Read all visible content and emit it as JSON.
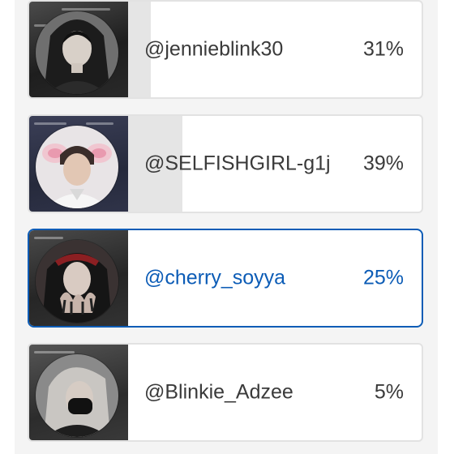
{
  "poll": {
    "options": [
      {
        "handle": "@jennieblink30",
        "percent_label": "31%",
        "percent": 31,
        "selected": false,
        "avatar": "profile-photo-jennieblink30"
      },
      {
        "handle": "@SELFISHGIRL-g1j",
        "percent_label": "39%",
        "percent": 39,
        "selected": false,
        "avatar": "profile-photo-selfishgirl"
      },
      {
        "handle": "@cherry_soyya",
        "percent_label": "25%",
        "percent": 25,
        "selected": true,
        "avatar": "profile-photo-cherry-soyya"
      },
      {
        "handle": "@Blinkie_Adzee",
        "percent_label": "5%",
        "percent": 5,
        "selected": false,
        "avatar": "profile-photo-blinkie-adzee"
      }
    ]
  },
  "colors": {
    "accent": "#0c5cb6",
    "bar_fill": "#e5e5e5",
    "selected_fill": "#eef5fd",
    "border": "#e2e2e2",
    "text": "#3a3a3a"
  }
}
